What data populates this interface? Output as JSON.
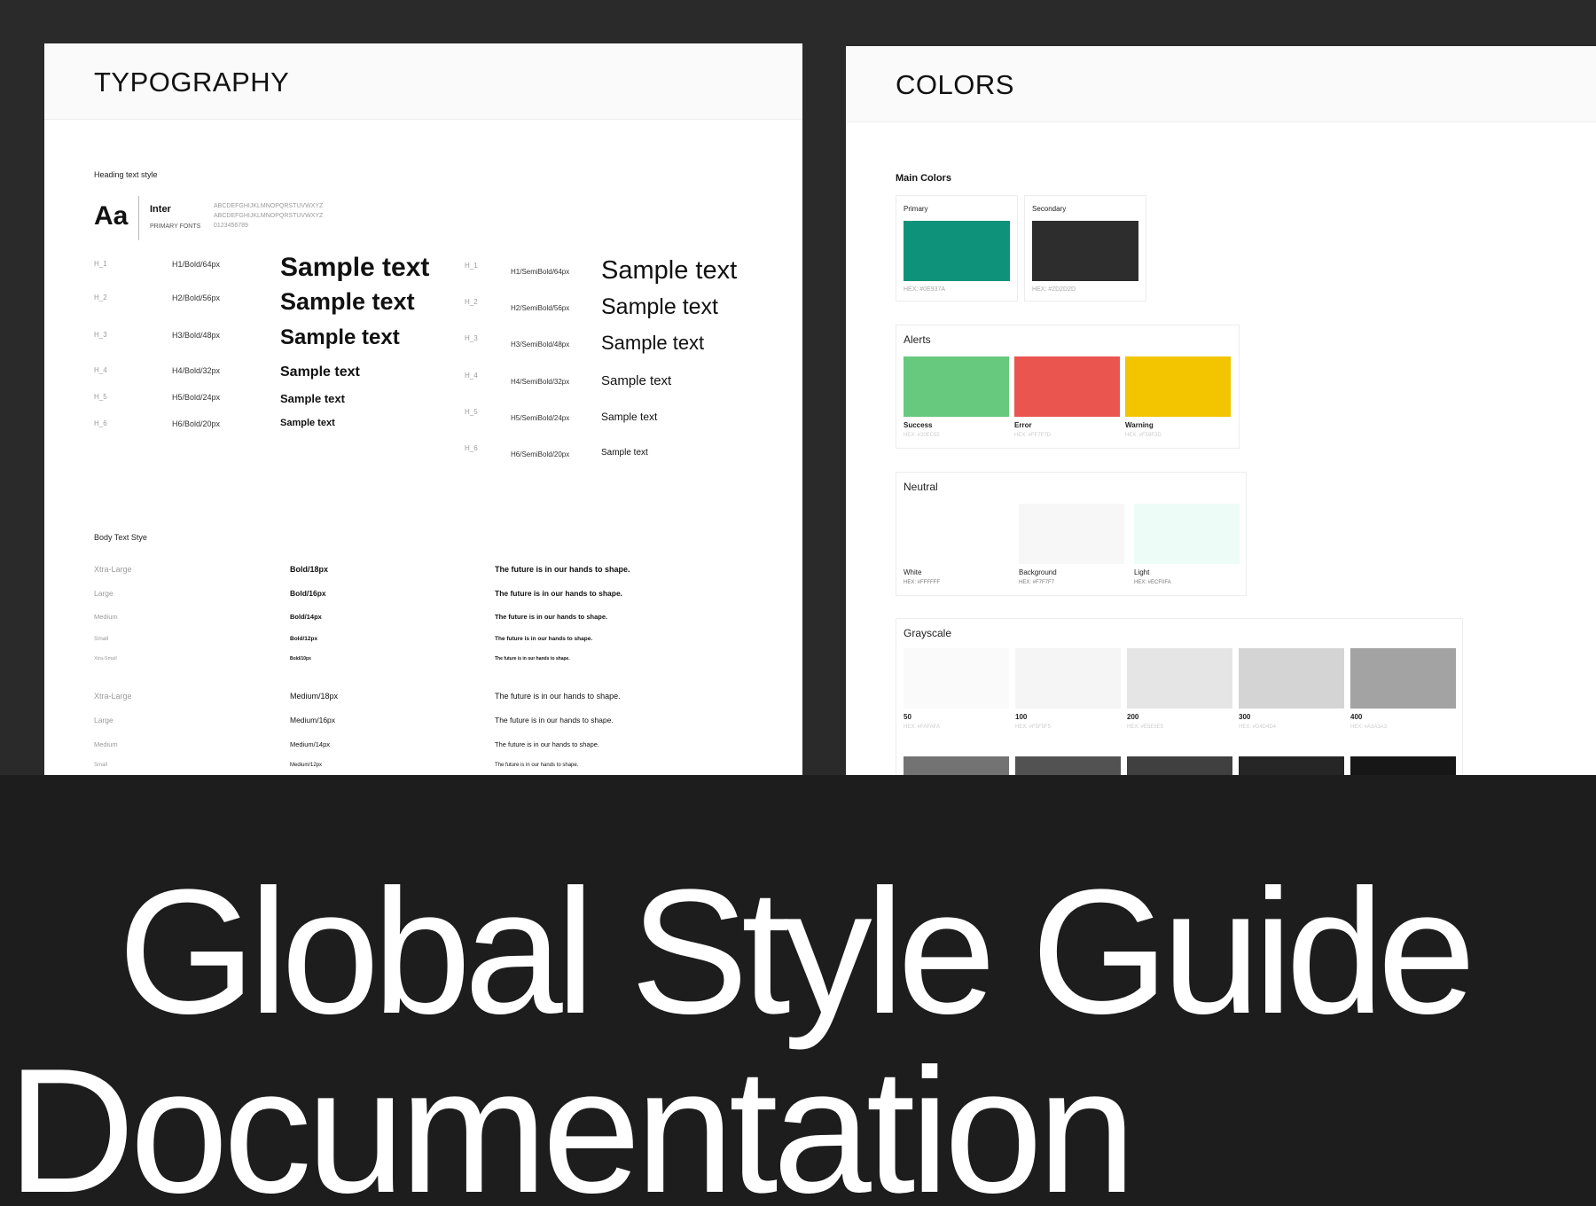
{
  "typography": {
    "title": "TYPOGRAPHY",
    "heading_section": "Heading text style",
    "font_sample": "Aa",
    "font_name": "Inter",
    "font_caption": "PRIMARY FONTS",
    "alphabet_upper": "ABCDEFGHIJKLMNOPQRSTUVWXYZ",
    "alphabet_lower": "ABCDEFGHIJKLMNOPQRSTUVWXYZ",
    "digits": "0123456789",
    "bold_headings": [
      {
        "tag": "H_1",
        "spec": "H1/Bold/64px",
        "sample": "Sample text"
      },
      {
        "tag": "H_2",
        "spec": "H2/Bold/56px",
        "sample": "Sample text"
      },
      {
        "tag": "H_3",
        "spec": "H3/Bold/48px",
        "sample": "Sample text"
      },
      {
        "tag": "H_4",
        "spec": "H4/Bold/32px",
        "sample": "Sample text"
      },
      {
        "tag": "H_5",
        "spec": "H5/Bold/24px",
        "sample": "Sample text"
      },
      {
        "tag": "H_6",
        "spec": "H6/Bold/20px",
        "sample": "Sample text"
      }
    ],
    "semibold_headings": [
      {
        "tag": "H_1",
        "spec": "H1/SemiBold/64px",
        "sample": "Sample text"
      },
      {
        "tag": "H_2",
        "spec": "H2/SemiBold/56px",
        "sample": "Sample text"
      },
      {
        "tag": "H_3",
        "spec": "H3/SemiBold/48px",
        "sample": "Sample text"
      },
      {
        "tag": "H_4",
        "spec": "H4/SemiBold/32px",
        "sample": "Sample text"
      },
      {
        "tag": "H_5",
        "spec": "H5/SemiBold/24px",
        "sample": "Sample text"
      },
      {
        "tag": "H_6",
        "spec": "H6/SemiBold/20px",
        "sample": "Sample text"
      }
    ],
    "body_section": "Body Text Stye",
    "body_bold": [
      {
        "size": "Xtra-Large",
        "spec": "Bold/18px",
        "sample": "The future is in our hands to shape."
      },
      {
        "size": "Large",
        "spec": "Bold/16px",
        "sample": "The future is in our hands to shape."
      },
      {
        "size": "Medium",
        "spec": "Bold/14px",
        "sample": "The future is in our hands to shape."
      },
      {
        "size": "Small",
        "spec": "Bold/12px",
        "sample": "The future is in our hands to shape."
      },
      {
        "size": "Xtra-Small",
        "spec": "Bold/10px",
        "sample": "The future is in our hands to shape."
      }
    ],
    "body_medium": [
      {
        "size": "Xtra-Large",
        "spec": "Medium/18px",
        "sample": "The future is in our hands to shape."
      },
      {
        "size": "Large",
        "spec": "Medium/16px",
        "sample": "The future is in our hands to shape."
      },
      {
        "size": "Medium",
        "spec": "Medium/14px",
        "sample": "The future is in our hands to shape."
      },
      {
        "size": "Small",
        "spec": "Medium/12px",
        "sample": "The future is in our hands to shape."
      }
    ]
  },
  "colors": {
    "title": "COLORS",
    "main_title": "Main Colors",
    "main": [
      {
        "name": "Primary",
        "hex_label": "HEX: #0E937A",
        "color": "#0E937A"
      },
      {
        "name": "Secondary",
        "hex_label": "HEX: #2D2D2D",
        "color": "#2D2D2D"
      }
    ],
    "alerts_title": "Alerts",
    "alerts": [
      {
        "name": "Success",
        "hex_label": "HEX: #20EC55",
        "color": "#66C97E"
      },
      {
        "name": "Error",
        "hex_label": "HEX: #FF7F7D",
        "color": "#EA5550"
      },
      {
        "name": "Warning",
        "hex_label": "HEX: #F59F3D",
        "color": "#F2C500"
      }
    ],
    "neutral_title": "Neutral",
    "neutral": [
      {
        "name": "White",
        "hex_label": "HEX: #FFFFFF",
        "color": "#FFFFFF"
      },
      {
        "name": "Background",
        "hex_label": "HEX: #F7F7F7",
        "color": "#F7F7F7"
      },
      {
        "name": "Light",
        "hex_label": "HEX: #ECF0FA",
        "color": "#EEFCF8"
      }
    ],
    "grayscale_title": "Grayscale",
    "grayscale": [
      {
        "name": "50",
        "hex_label": "HEX: #FAFAFA",
        "color": "#FAFAFA"
      },
      {
        "name": "100",
        "hex_label": "HEX: #F5F5F5",
        "color": "#F5F5F5"
      },
      {
        "name": "200",
        "hex_label": "HEX: #E5E5E5",
        "color": "#E5E5E5"
      },
      {
        "name": "300",
        "hex_label": "HEX: #D4D4D4",
        "color": "#D4D4D4"
      },
      {
        "name": "400",
        "hex_label": "HEX: #A3A3A3",
        "color": "#A3A3A3"
      }
    ],
    "grayscale_dark": [
      "#737373",
      "#525252",
      "#404040",
      "#262626",
      "#171717"
    ]
  },
  "hero": {
    "line1": "Global Style Guide",
    "line2": "Documentation"
  }
}
